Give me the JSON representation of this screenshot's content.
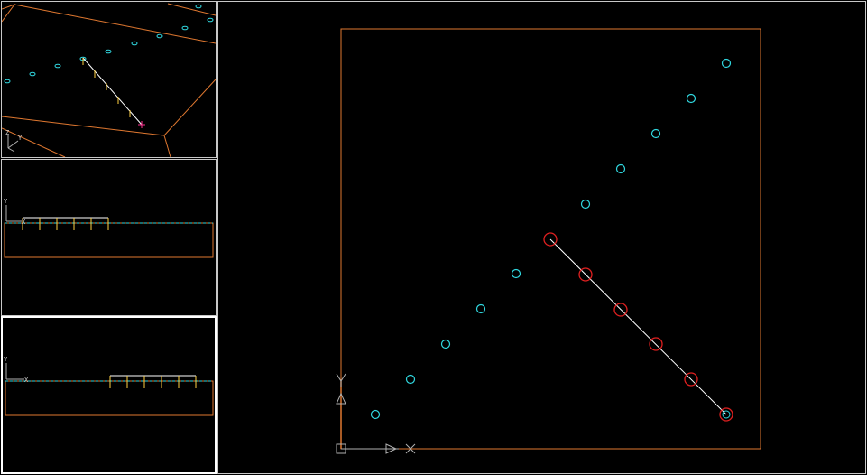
{
  "app": {
    "title": ""
  },
  "viewports": {
    "perspective": {
      "axis_labels": {
        "z": "Z",
        "y": "Y",
        "x": "X"
      }
    },
    "front": {
      "axis_labels": {
        "y": "Y",
        "x": "X"
      }
    },
    "side": {
      "axis_labels": {
        "y": "Y",
        "x": "X"
      }
    },
    "top": {
      "axis_labels": {
        "y": "Y",
        "x": "X"
      }
    }
  },
  "colors": {
    "boundary": "#e07830",
    "hole_marker": "#30d8e0",
    "selected_marker": "#e02020",
    "path_line": "#ffffff",
    "axis_y": "#e07830",
    "axis_x": "#b0b0b0",
    "pick_marker": "#ff3090",
    "tick_marks": "#ffd040"
  },
  "icons": [
    "origin-square-icon",
    "y-axis-arrow-icon",
    "x-axis-arrow-icon",
    "view-axis-triad-icon"
  ]
}
